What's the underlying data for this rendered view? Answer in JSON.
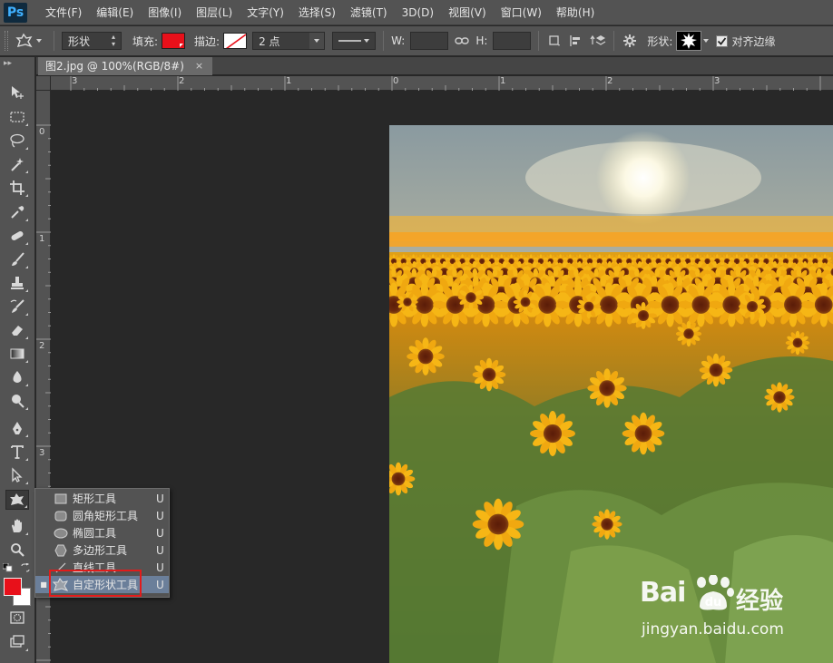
{
  "app": {
    "logo": "Ps"
  },
  "menu": [
    "文件(F)",
    "编辑(E)",
    "图像(I)",
    "图层(L)",
    "文字(Y)",
    "选择(S)",
    "滤镜(T)",
    "3D(D)",
    "视图(V)",
    "窗口(W)",
    "帮助(H)"
  ],
  "options": {
    "mode_value": "形状",
    "fill_label": "填充:",
    "fill_color": "#e8101a",
    "stroke_label": "描边:",
    "stroke_width": "2 点",
    "w_label": "W:",
    "h_label": "H:",
    "shape_label": "形状:",
    "align_edges_label": "对齐边缘",
    "align_edges_checked": true
  },
  "document": {
    "tab_title": "图2.jpg @ 100%(RGB/8#)",
    "close": "×"
  },
  "ruler_top": [
    "3",
    "2",
    "1",
    "0",
    "1",
    "2",
    "3"
  ],
  "ruler_left": [
    "0",
    "1",
    "2",
    "3"
  ],
  "flyout": {
    "items": [
      {
        "label": "矩形工具",
        "key": "U",
        "icon": "rectangle-icon"
      },
      {
        "label": "圆角矩形工具",
        "key": "U",
        "icon": "rounded-rectangle-icon"
      },
      {
        "label": "椭圆工具",
        "key": "U",
        "icon": "ellipse-icon"
      },
      {
        "label": "多边形工具",
        "key": "U",
        "icon": "polygon-icon"
      },
      {
        "label": "直线工具",
        "key": "U",
        "icon": "line-icon"
      },
      {
        "label": "自定形状工具",
        "key": "U",
        "icon": "custom-shape-icon",
        "selected": true
      }
    ]
  },
  "colors": {
    "foreground": "#e8101a",
    "background": "#ffffff",
    "highlight": "#e21b1b"
  },
  "watermark": {
    "brand": "Bai",
    "jingyan": "经验",
    "url": "jingyan.baidu.com"
  }
}
